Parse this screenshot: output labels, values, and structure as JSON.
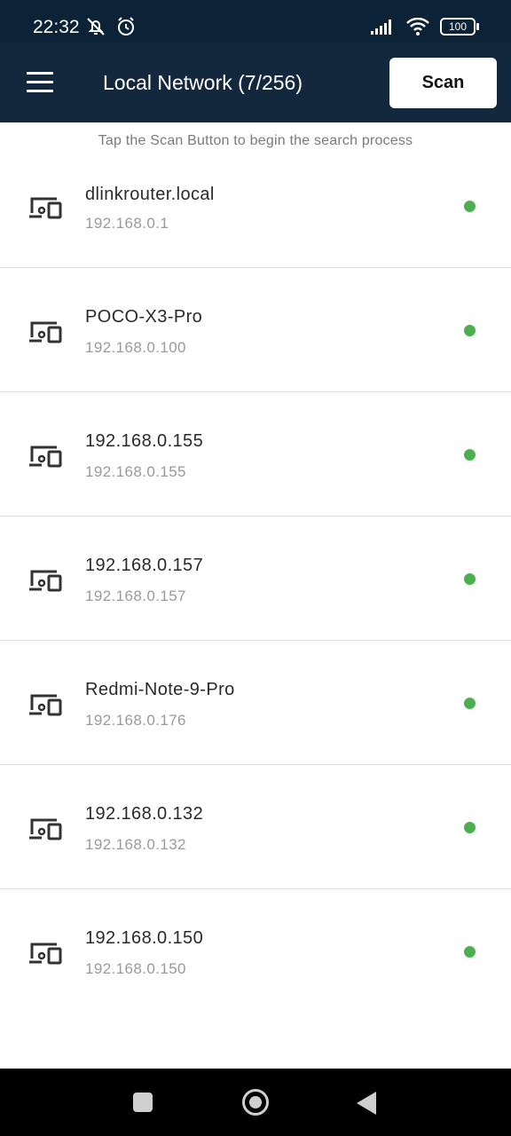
{
  "status_bar": {
    "time": "22:32",
    "battery": "100",
    "icons": [
      "mute-notifications-icon",
      "alarm-icon",
      "signal-icon",
      "wifi-icon",
      "battery-icon"
    ]
  },
  "app_bar": {
    "title": "Local Network (7/256)",
    "scan_label": "Scan",
    "menu_icon": "hamburger-menu-icon"
  },
  "hint": "Tap the Scan Button to begin the search process",
  "colors": {
    "status_bar_bg": "#0c2236",
    "app_bar_bg": "#13273d",
    "online_dot": "#4caf50"
  },
  "devices": [
    {
      "name": "dlinkrouter.local",
      "ip": "192.168.0.1"
    },
    {
      "name": "POCO-X3-Pro",
      "ip": "192.168.0.100"
    },
    {
      "name": "192.168.0.155",
      "ip": "192.168.0.155"
    },
    {
      "name": "192.168.0.157",
      "ip": "192.168.0.157"
    },
    {
      "name": "Redmi-Note-9-Pro",
      "ip": "192.168.0.176"
    },
    {
      "name": "192.168.0.132",
      "ip": "192.168.0.132"
    },
    {
      "name": "192.168.0.150",
      "ip": "192.168.0.150"
    }
  ]
}
